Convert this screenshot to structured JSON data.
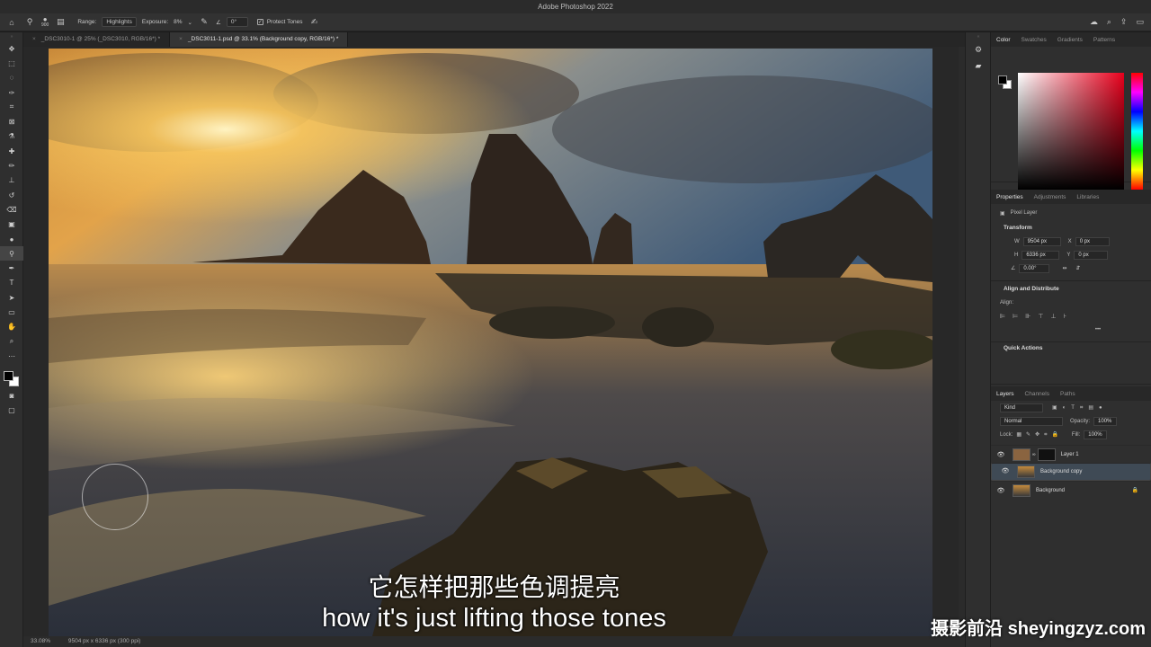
{
  "app_title": "Adobe Photoshop 2022",
  "options_bar": {
    "brush_size": "900",
    "range_label": "Range:",
    "range_value": "Highlights",
    "exposure_label": "Exposure:",
    "exposure_value": "8%",
    "angle_value": "0°",
    "protect_tones_label": "Protect Tones",
    "protect_tones_checked": true
  },
  "tabs": [
    {
      "label": "_DSC3010-1 @ 25% (_DSC3010, RGB/16*) *",
      "active": false
    },
    {
      "label": "_DSC3011-1.psd @ 33.1% (Background copy, RGB/16*) *",
      "active": true
    }
  ],
  "status": {
    "zoom": "33.08%",
    "doc_info": "9504 px x 6336 px (300 ppi)"
  },
  "subtitles": {
    "chinese": "它怎样把那些色调提亮",
    "english": "how it's just lifting those tones"
  },
  "watermark": "摄影前沿 sheyingzyz.com",
  "color_panel": {
    "tabs": [
      "Color",
      "Swatches",
      "Gradients",
      "Patterns"
    ],
    "active_tab": "Color",
    "foreground": "#000000",
    "background": "#ffffff"
  },
  "properties_panel": {
    "tabs": [
      "Properties",
      "Adjustments",
      "Libraries"
    ],
    "layer_type": "Pixel Layer",
    "transform_label": "Transform",
    "w_label": "W",
    "w_value": "9504 px",
    "h_label": "H",
    "h_value": "6336 px",
    "x_label": "X",
    "x_value": "0 px",
    "y_label": "Y",
    "y_value": "0 px",
    "angle_value": "0.00°",
    "align_section": "Align and Distribute",
    "align_label": "Align:",
    "quick_actions": "Quick Actions"
  },
  "layers_panel": {
    "tabs": [
      "Layers",
      "Channels",
      "Paths"
    ],
    "filter_kind": "Kind",
    "blend_mode": "Normal",
    "opacity_label": "Opacity:",
    "opacity_value": "100%",
    "lock_label": "Lock:",
    "fill_label": "Fill:",
    "fill_value": "100%",
    "layers": [
      {
        "name": "Layer 1",
        "selected": false
      },
      {
        "name": "Background copy",
        "selected": true
      },
      {
        "name": "Background",
        "selected": false
      }
    ]
  },
  "tools": [
    "move-tool",
    "marquee-tool",
    "lasso-tool",
    "quick-select-tool",
    "crop-tool",
    "frame-tool",
    "eyedropper-tool",
    "healing-tool",
    "brush-tool",
    "clone-stamp-tool",
    "history-brush-tool",
    "eraser-tool",
    "gradient-tool",
    "blur-tool",
    "dodge-tool",
    "pen-tool",
    "type-tool",
    "path-select-tool",
    "rectangle-tool",
    "hand-tool",
    "zoom-tool",
    "more-tools"
  ]
}
